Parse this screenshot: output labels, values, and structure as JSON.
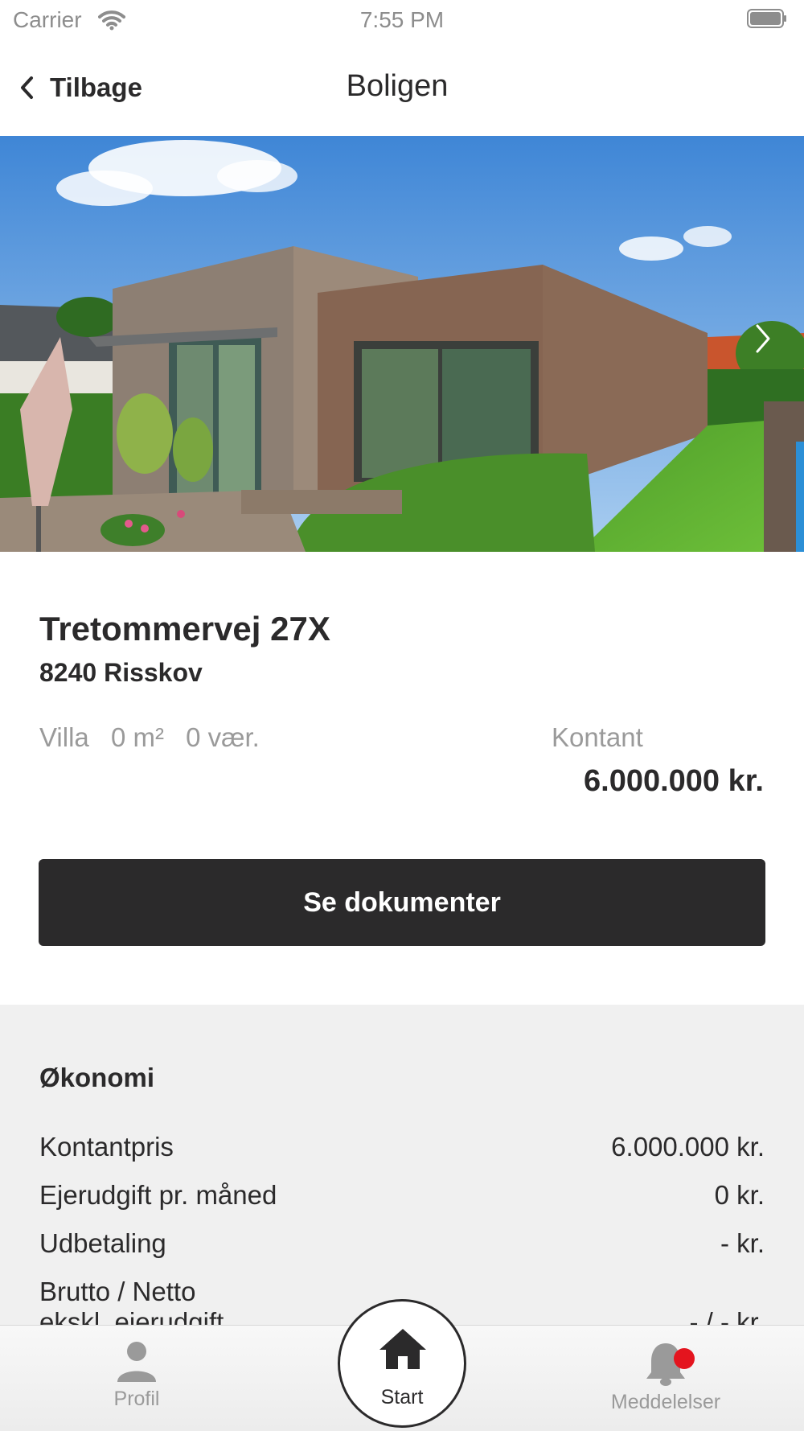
{
  "status_bar": {
    "carrier": "Carrier",
    "time": "7:55 PM"
  },
  "nav": {
    "back_label": "Tilbage",
    "title": "Boligen"
  },
  "property": {
    "street": "Tretommervej 27X",
    "city": "8240 Risskov",
    "type": "Villa",
    "area": "0 m²",
    "rooms": "0 vær.",
    "price_label": "Kontant",
    "price_value": "6.000.000 kr."
  },
  "documents_button": "Se dokumenter",
  "economy": {
    "title": "Økonomi",
    "rows": [
      {
        "label": "Kontantpris",
        "value": "6.000.000 kr."
      },
      {
        "label": "Ejerudgift pr. måned",
        "value": "0 kr."
      },
      {
        "label": "Udbetaling",
        "value": "- kr."
      },
      {
        "label": "Brutto / Netto\nekskl. ejerudgift",
        "value": "- / - kr."
      }
    ]
  },
  "tabs": [
    {
      "label": "Profil",
      "icon": "person-icon"
    },
    {
      "label": "Start",
      "icon": "home-icon"
    },
    {
      "label": "Meddelelser",
      "icon": "bell-icon"
    }
  ],
  "colors": {
    "primary": "#2b2a2b",
    "muted": "#9a9a9a",
    "badge": "#e4141e",
    "section_bg": "#f0f0f0"
  }
}
